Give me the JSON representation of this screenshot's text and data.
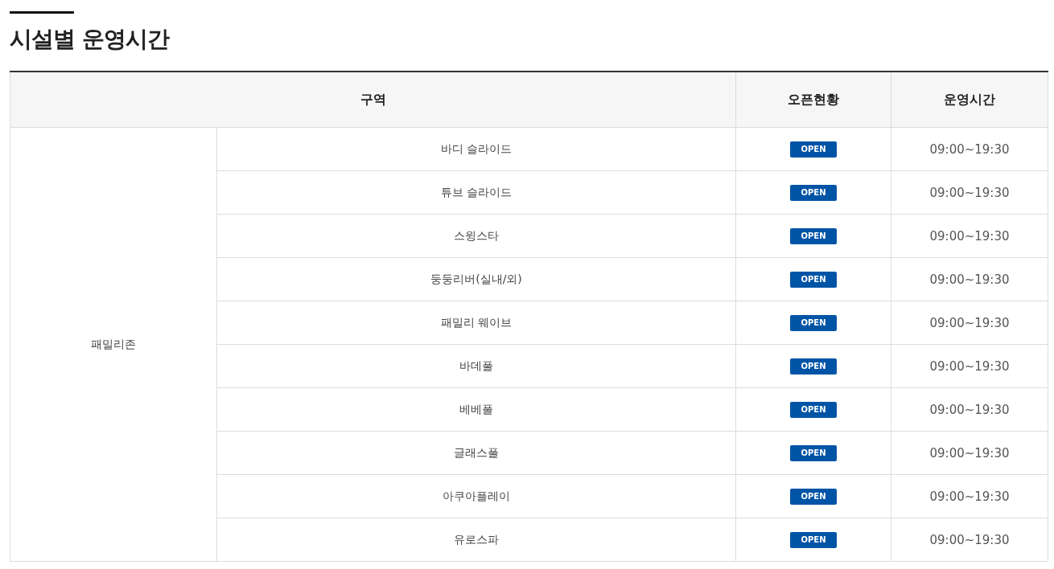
{
  "title": "시설별 운영시간",
  "table": {
    "columns": [
      "구역",
      "오픈현황",
      "운영시간"
    ],
    "groups": [
      {
        "zone": "패밀리존",
        "rows": [
          {
            "facility": "바디 슬라이드",
            "status": "OPEN",
            "hours": "09:00~19:30"
          },
          {
            "facility": "튜브 슬라이드",
            "status": "OPEN",
            "hours": "09:00~19:30"
          },
          {
            "facility": "스윙스타",
            "status": "OPEN",
            "hours": "09:00~19:30"
          },
          {
            "facility": "둥둥리버(실내/외)",
            "status": "OPEN",
            "hours": "09:00~19:30"
          },
          {
            "facility": "패밀리 웨이브",
            "status": "OPEN",
            "hours": "09:00~19:30"
          },
          {
            "facility": "바데풀",
            "status": "OPEN",
            "hours": "09:00~19:30"
          },
          {
            "facility": "베베풀",
            "status": "OPEN",
            "hours": "09:00~19:30"
          },
          {
            "facility": "글래스풀",
            "status": "OPEN",
            "hours": "09:00~19:30"
          },
          {
            "facility": "아쿠아플레이",
            "status": "OPEN",
            "hours": "09:00~19:30"
          },
          {
            "facility": "유로스파",
            "status": "OPEN",
            "hours": "09:00~19:30"
          }
        ]
      }
    ]
  }
}
